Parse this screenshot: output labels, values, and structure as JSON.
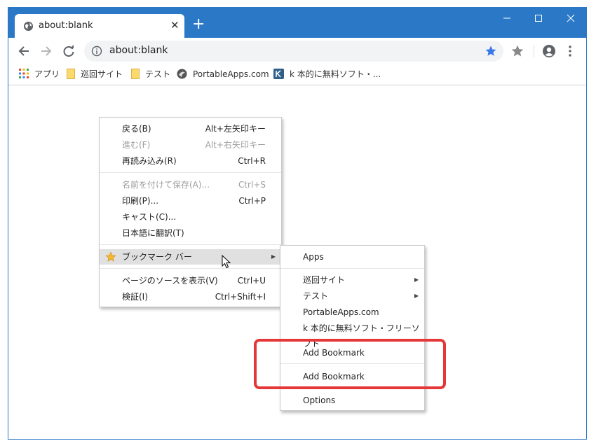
{
  "tab": {
    "title": "about:blank",
    "close": "✕"
  },
  "newtab": "+",
  "omnibox": {
    "url": "about:blank"
  },
  "bookmarks_bar": [
    {
      "label": "アプリ",
      "icon": "apps-grid-icon"
    },
    {
      "label": "巡回サイト",
      "icon": "folder-icon"
    },
    {
      "label": "テスト",
      "icon": "folder-icon"
    },
    {
      "label": "PortableApps.com",
      "icon": "portableapps-icon"
    },
    {
      "label": "k 本的に無料ソフト・...",
      "icon": "k-site-icon"
    }
  ],
  "context_menu": {
    "items": [
      {
        "label": "戻る(B)",
        "accel": "Alt+左矢印キー",
        "disabled": false
      },
      {
        "label": "進む(F)",
        "accel": "Alt+右矢印キー",
        "disabled": true
      },
      {
        "label": "再読み込み(R)",
        "accel": "Ctrl+R",
        "disabled": false
      },
      {
        "label": "名前を付けて保存(A)...",
        "accel": "Ctrl+S",
        "disabled": true
      },
      {
        "label": "印刷(P)...",
        "accel": "Ctrl+P",
        "disabled": false
      },
      {
        "label": "キャスト(C)...",
        "accel": "",
        "disabled": false
      },
      {
        "label": "日本語に翻訳(T)",
        "accel": "",
        "disabled": false
      },
      {
        "label": "ブックマーク バー",
        "accel": "",
        "disabled": false,
        "highlighted": true,
        "submenu": true
      },
      {
        "label": "ページのソースを表示(V)",
        "accel": "Ctrl+U",
        "disabled": false
      },
      {
        "label": "検証(I)",
        "accel": "Ctrl+Shift+I",
        "disabled": false
      }
    ]
  },
  "submenu": {
    "items": [
      {
        "label": "Apps"
      },
      {
        "label": "巡回サイト",
        "submenu": true
      },
      {
        "label": "テスト",
        "submenu": true
      },
      {
        "label": "PortableApps.com"
      },
      {
        "label": "k 本的に無料ソフト・フリーソフト"
      },
      {
        "label": "Add Bookmark"
      },
      {
        "label": "Add Bookmark"
      },
      {
        "label": "Options"
      }
    ]
  },
  "colors": {
    "titlebar": "#2b78c7",
    "highlight": "#e53737",
    "star": "#4285f4"
  }
}
